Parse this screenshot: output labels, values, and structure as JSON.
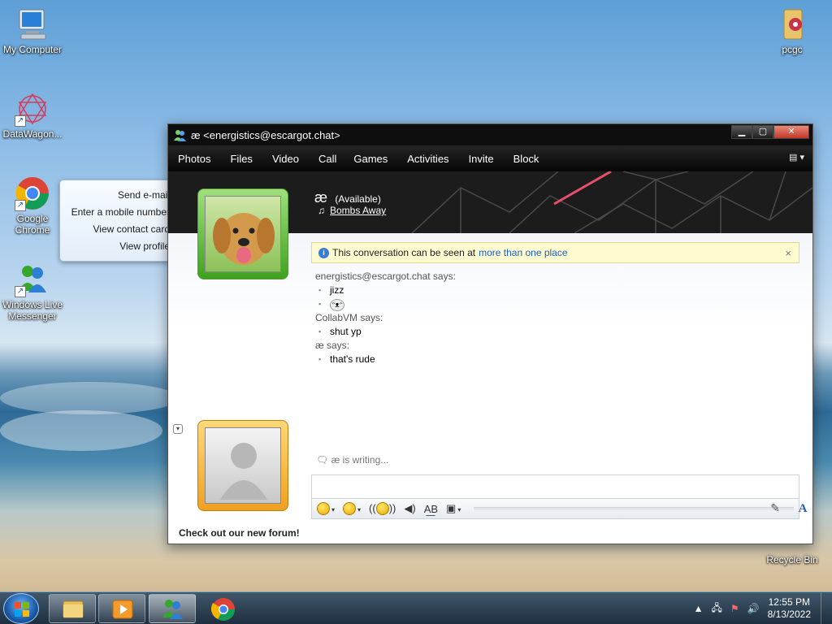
{
  "desktop": {
    "icons": [
      {
        "label": "My Computer"
      },
      {
        "label": "DataWagon..."
      },
      {
        "label": "Google Chrome"
      },
      {
        "label": "Windows Live Messenger"
      },
      {
        "label": "pcgc"
      },
      {
        "label": "Recycle Bin"
      }
    ]
  },
  "context_menu": {
    "items": [
      "Send e-mail",
      "Enter a mobile number",
      "View contact card",
      "View profile"
    ]
  },
  "window": {
    "title": "æ <energistics@escargot.chat>",
    "menu": [
      "Photos",
      "Files",
      "Video",
      "Call",
      "Games",
      "Activities",
      "Invite",
      "Block"
    ],
    "contact": {
      "name": "æ",
      "status": "(Available)",
      "song": "Bombs Away"
    },
    "infobar": {
      "text": "This conversation can be seen at",
      "link": "more than one place",
      "close": "×"
    },
    "messages": [
      {
        "sender": "energistics@escargot.chat says:",
        "lines": [
          "jizz",
          "[emoticon]"
        ]
      },
      {
        "sender": "CollabVM says:",
        "lines": [
          "shut yp"
        ]
      },
      {
        "sender": "æ says:",
        "lines": [
          "that's rude"
        ]
      }
    ],
    "typing": "æ is writing...",
    "footer": "Check out our new forum!"
  },
  "taskbar": {
    "time": "12:55 PM",
    "date": "8/13/2022"
  },
  "colors": {
    "accent_link": "#1a5fc4",
    "own_frame": "#f0a020",
    "contact_frame": "#3ea21e"
  }
}
